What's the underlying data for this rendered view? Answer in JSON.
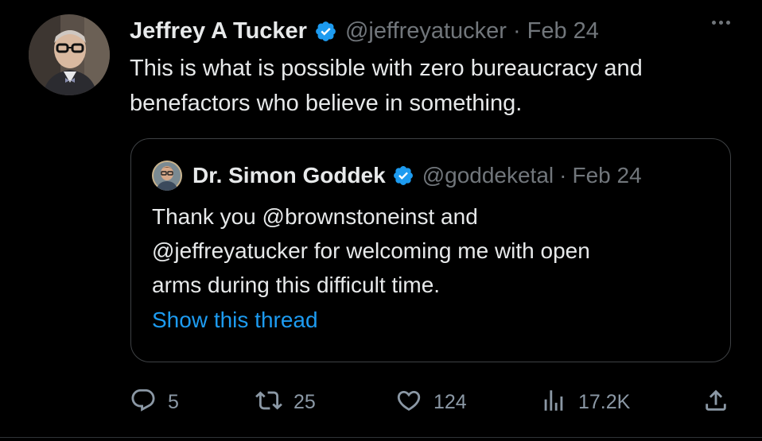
{
  "tweet": {
    "author_name": "Jeffrey A Tucker",
    "handle": "@jeffreyatucker",
    "dot": "·",
    "date": "Feb 24",
    "text_lines": [
      "This is what is possible with zero bureaucracy and",
      "benefactors who believe in something."
    ]
  },
  "quoted": {
    "author_name": "Dr. Simon Goddek",
    "handle": "@goddeketal",
    "dot": "·",
    "date": "Feb 24",
    "text_lines": [
      "Thank you @brownstoneinst and",
      "@jeffreyatucker for welcoming me with open",
      "arms during this difficult time."
    ],
    "show_thread": "Show this thread"
  },
  "actions": {
    "replies": "5",
    "retweets": "25",
    "likes": "124",
    "views": "17.2K"
  },
  "icons": {
    "verified": "verified-badge-icon",
    "more": "more-icon",
    "reply": "reply-icon",
    "retweet": "retweet-icon",
    "like": "heart-icon",
    "views": "views-icon",
    "share": "share-icon"
  },
  "colors": {
    "background": "#000000",
    "text": "#e7e9ea",
    "secondary": "#71767b",
    "accent": "#1d9bf0",
    "border": "#3e4144"
  }
}
